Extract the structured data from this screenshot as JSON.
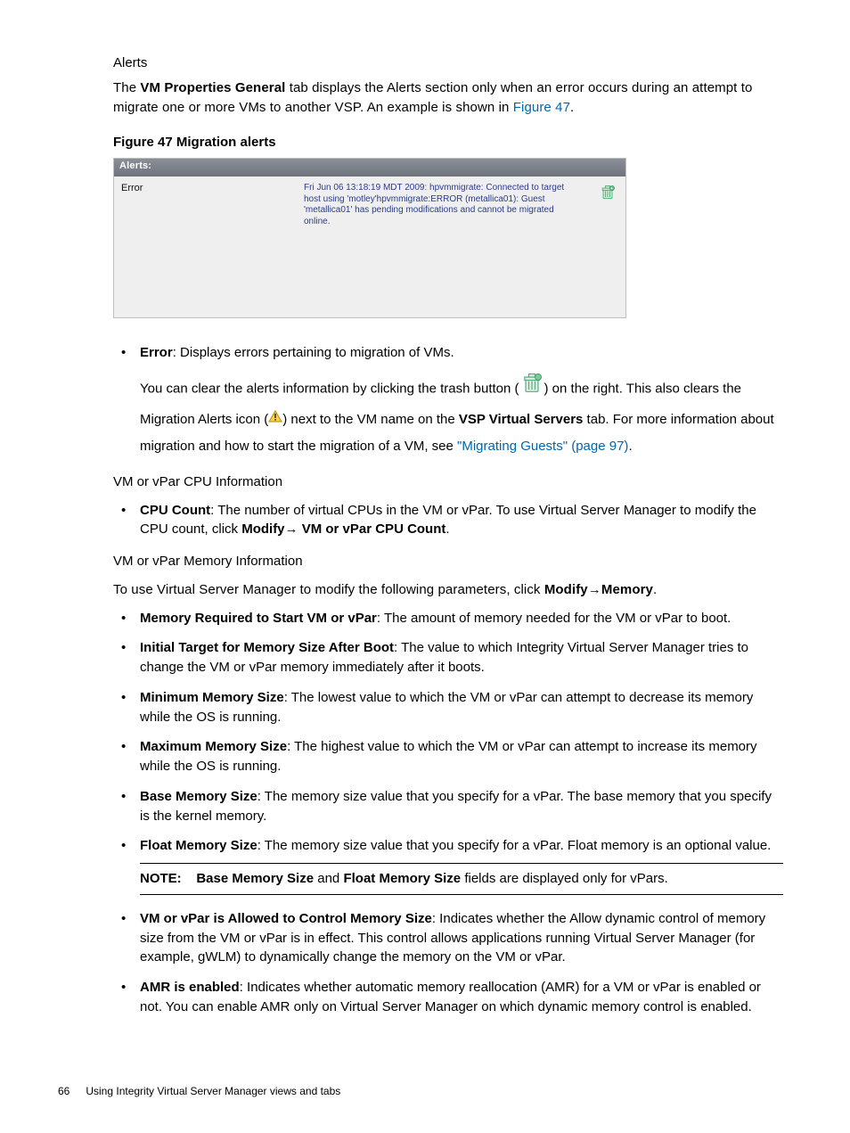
{
  "section_heading_alerts": "Alerts",
  "intro_sentence": {
    "pre": "The ",
    "bold": "VM Properties General",
    "mid": " tab displays the Alerts section only when an error occurs during an attempt to migrate one or more VMs to another VSP. An example is shown in ",
    "link": "Figure 47",
    "post": "."
  },
  "figure_caption": "Figure 47 Migration alerts",
  "figure": {
    "header": "Alerts:",
    "left_label": "Error",
    "message": "Fri Jun 06 13:18:19 MDT 2009: hpvmmigrate: Connected to target host using 'motley'hpvmmigrate:ERROR (metallica01): Guest 'metallica01' has pending modifications and cannot be migrated online."
  },
  "error_bullet": {
    "label": "Error",
    "text": ": Displays errors pertaining to migration of VMs.",
    "p2_a": "You can clear the alerts information by clicking the trash button (",
    "p2_b": ") on the right. This also clears the Migration Alerts icon (",
    "p2_c": ") next to the VM name on the ",
    "p2_bold": "VSP Virtual Servers",
    "p2_d": " tab. For more information about migration and how to start the migration of a VM, see ",
    "p2_link": "\"Migrating Guests\" (page 97)",
    "p2_e": "."
  },
  "cpu_heading": "VM or vPar CPU Information",
  "cpu_bullet": {
    "label": "CPU Count",
    "text_a": ": The number of virtual CPUs in the VM or vPar. To use Virtual Server Manager to modify the CPU count, click ",
    "bold_a": "Modify",
    "arrow": "→",
    "bold_b": " VM or vPar CPU Count",
    "text_b": "."
  },
  "mem_heading": "VM or vPar Memory Information",
  "mem_intro": {
    "a": "To use Virtual Server Manager to modify the following parameters, click ",
    "bold_a": "Modify",
    "arrow": "→",
    "bold_b": "Memory",
    "b": "."
  },
  "mem_bullets": [
    {
      "label": "Memory Required to Start VM or vPar",
      "text": ": The amount of memory needed for the VM or vPar to boot."
    },
    {
      "label": "Initial Target for Memory Size After Boot",
      "text": ": The value to which Integrity Virtual Server Manager tries to change the VM or vPar memory immediately after it boots."
    },
    {
      "label": "Minimum Memory Size",
      "text": ": The lowest value to which the VM or vPar can attempt to decrease its memory while the OS is running."
    },
    {
      "label": "Maximum Memory Size",
      "text": ": The highest value to which the VM or vPar can attempt to increase its memory while the OS is running."
    },
    {
      "label": "Base Memory Size",
      "text": ": The memory size value that you specify for a vPar. The base memory that you specify is the kernel memory."
    },
    {
      "label": "Float Memory Size",
      "text": ": The memory size value that you specify for a vPar. Float memory is an optional value."
    }
  ],
  "note": {
    "label": "NOTE:",
    "a": "Base Memory Size",
    "mid": " and ",
    "b": "Float Memory Size",
    "rest": " fields are displayed only for vPars."
  },
  "mem_bullets_2": [
    {
      "label": "VM or vPar is Allowed to Control Memory Size",
      "text": ": Indicates whether the Allow dynamic control of memory size from the VM or vPar is in effect. This control allows applications running Virtual Server Manager (for example, gWLM) to dynamically change the memory on the VM or vPar."
    },
    {
      "label": "AMR is enabled",
      "text": ": Indicates whether automatic memory reallocation (AMR) for a VM or vPar is enabled or not. You can enable AMR only on Virtual Server Manager on which dynamic memory control is enabled."
    }
  ],
  "footer": {
    "page": "66",
    "title": "Using Integrity Virtual Server Manager views and tabs"
  }
}
